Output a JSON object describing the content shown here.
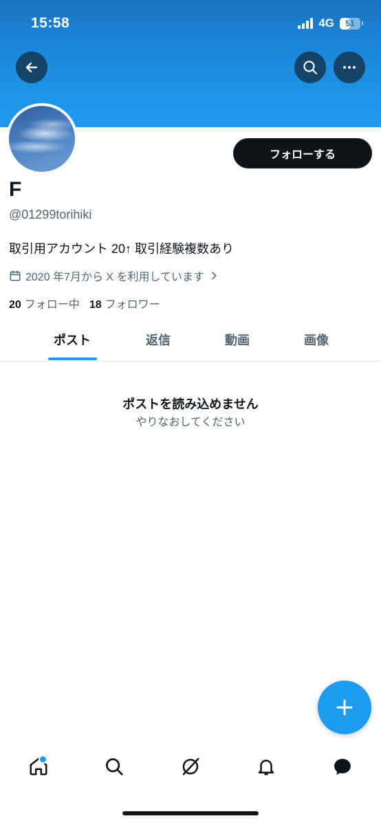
{
  "status_bar": {
    "time": "15:58",
    "network": "4G",
    "battery": "51",
    "battery_level": 0.51
  },
  "header": {
    "back_icon": "arrow-left-icon",
    "search_icon": "search-icon",
    "more_icon": "more-horizontal-icon"
  },
  "profile": {
    "follow_label": "フォローする",
    "display_name": "F",
    "handle": "@01299torihiki",
    "bio": "取引用アカウント 20↑ 取引経験複数あり",
    "joined": "2020 年7月から X を利用しています",
    "following_count": "20",
    "following_label": "フォロー中",
    "followers_count": "18",
    "followers_label": "フォロワー"
  },
  "tabs": [
    {
      "label": "ポスト",
      "active": true
    },
    {
      "label": "返信",
      "active": false
    },
    {
      "label": "動画",
      "active": false
    },
    {
      "label": "画像",
      "active": false
    }
  ],
  "empty_state": {
    "title": "ポストを読み込めません",
    "subtitle": "やりなおしてください"
  },
  "bottom_nav": [
    "home-icon",
    "search-icon",
    "grok-icon",
    "bell-icon",
    "messages-icon"
  ],
  "colors": {
    "accent": "#1d9bf0",
    "text": "#0f1419",
    "muted": "#536471"
  }
}
